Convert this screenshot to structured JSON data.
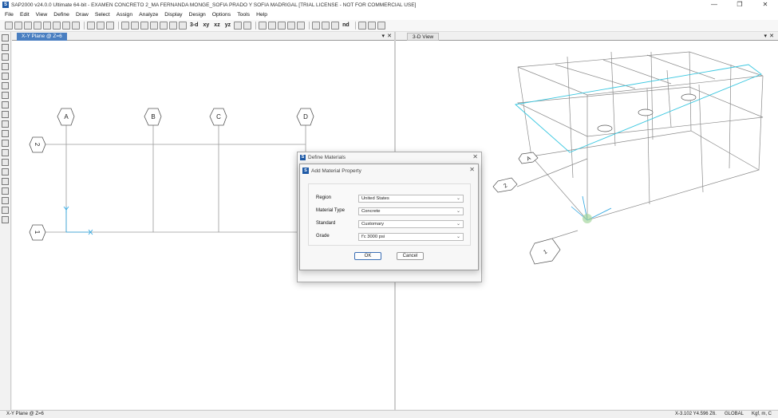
{
  "window": {
    "title": "SAP2000 v24.0.0 Ultimate 64-bit - EXAMEN CONCRETO 2_MA FERNANDA MONGE_SOFIA PRADO Y SOFIA MADRIGAL  [TRIAL LICENSE - NOT FOR COMMERCIAL USE]",
    "minimize": "—",
    "restore": "❐",
    "close": "✕"
  },
  "menu": [
    "File",
    "Edit",
    "View",
    "Define",
    "Draw",
    "Select",
    "Assign",
    "Analyze",
    "Display",
    "Design",
    "Options",
    "Tools",
    "Help"
  ],
  "toolbar": {
    "view_3d": "3-d",
    "view_xy": "xy",
    "view_xz": "xz",
    "view_yz": "yz",
    "nd": "nd"
  },
  "left_view": {
    "tab": "X-Y Plane @ Z=6",
    "grid_x": [
      "A",
      "B",
      "C",
      "D"
    ],
    "grid_y": [
      "2",
      "1"
    ]
  },
  "right_view": {
    "tab": "3-D View",
    "bubbles": [
      "A",
      "2",
      "1"
    ]
  },
  "tab_controls": {
    "dropdown": "▾",
    "close": "✕"
  },
  "define_materials": {
    "title": "Define Materials",
    "close": "✕"
  },
  "add_material": {
    "title": "Add Material Property",
    "close": "✕",
    "fields": [
      {
        "label": "Region",
        "value": "United States"
      },
      {
        "label": "Material Type",
        "value": "Concrete"
      },
      {
        "label": "Standard",
        "value": "Customary"
      },
      {
        "label": "Grade",
        "value": "f'c 3000 psi"
      }
    ],
    "ok": "OK",
    "cancel": "Cancel"
  },
  "status": {
    "left": "X-Y Plane @ Z=6",
    "coords": "X-3.102  Y4.596  Z6.",
    "system": "GLOBAL",
    "units": "Kgf, m, C"
  },
  "colors": {
    "tab_active": "#4a7fc1",
    "grid_line": "#9a9a9a",
    "highlight": "#39c7e0",
    "axes": "#2aa4e0",
    "sap_blue": "#1f5aa6"
  }
}
